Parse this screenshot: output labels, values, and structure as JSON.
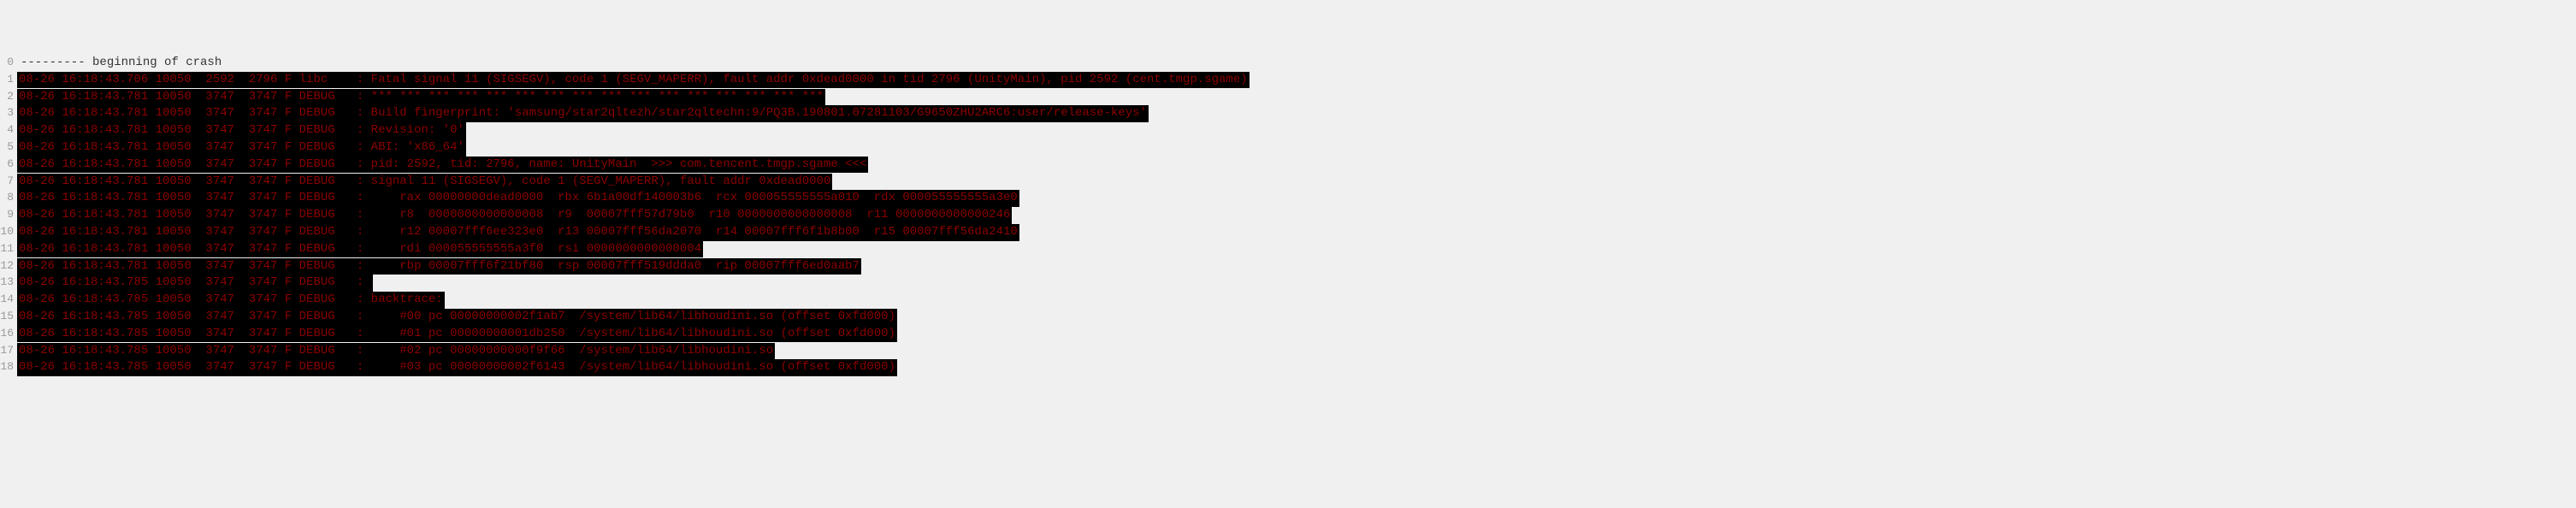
{
  "header": "--------- beginning of crash",
  "lines": [
    {
      "num": 1,
      "content": "08-26 16:18:43.706 10050  2592  2796 F libc    : Fatal signal 11 (SIGSEGV), code 1 (SEGV_MAPERR), fault addr 0xdead0000 in tid 2796 (UnityMain), pid 2592 (cent.tmgp.sgame)"
    },
    {
      "num": 2,
      "content": "08-26 16:18:43.781 10050  3747  3747 F DEBUG   : *** *** *** *** *** *** *** *** *** *** *** *** *** *** *** ***"
    },
    {
      "num": 3,
      "content": "08-26 16:18:43.781 10050  3747  3747 F DEBUG   : Build fingerprint: 'samsung/star2qltezh/star2qltechn:9/PQ3B.190801.07281103/G9650ZHU2ARC6:user/release-keys'"
    },
    {
      "num": 4,
      "content": "08-26 16:18:43.781 10050  3747  3747 F DEBUG   : Revision: '0'"
    },
    {
      "num": 5,
      "content": "08-26 16:18:43.781 10050  3747  3747 F DEBUG   : ABI: 'x86_64'"
    },
    {
      "num": 6,
      "content": "08-26 16:18:43.781 10050  3747  3747 F DEBUG   : pid: 2592, tid: 2796, name: UnityMain  >>> com.tencent.tmgp.sgame <<<"
    },
    {
      "num": 7,
      "content": "08-26 16:18:43.781 10050  3747  3747 F DEBUG   : signal 11 (SIGSEGV), code 1 (SEGV_MAPERR), fault addr 0xdead0000"
    },
    {
      "num": 8,
      "content": "08-26 16:18:43.781 10050  3747  3747 F DEBUG   :     rax 00000000dead0000  rbx 6b1a00df140003b6  rcx 000055555555a010  rdx 000055555555a3e0"
    },
    {
      "num": 9,
      "content": "08-26 16:18:43.781 10050  3747  3747 F DEBUG   :     r8  0000000000000008  r9  00007fff57d79b0  r10 0000000000000008  r11 0000000000000246"
    },
    {
      "num": 10,
      "content": "08-26 16:18:43.781 10050  3747  3747 F DEBUG   :     r12 00007fff6ee323e0  r13 00007fff56da2070  r14 00007fff6f1b8b00  r15 00007fff56da2410"
    },
    {
      "num": 11,
      "content": "08-26 16:18:43.781 10050  3747  3747 F DEBUG   :     rdi 000055555555a3f0  rsi 0000000000000004"
    },
    {
      "num": 12,
      "content": "08-26 16:18:43.781 10050  3747  3747 F DEBUG   :     rbp 00007fff6f21bf80  rsp 00007fff519ddda0  rip 00007fff6ed0aab7"
    },
    {
      "num": 13,
      "content": "08-26 16:18:43.785 10050  3747  3747 F DEBUG   : "
    },
    {
      "num": 14,
      "content": "08-26 16:18:43.785 10050  3747  3747 F DEBUG   : backtrace:"
    },
    {
      "num": 15,
      "content": "08-26 16:18:43.785 10050  3747  3747 F DEBUG   :     #00 pc 00000000002f1ab7  /system/lib64/libhoudini.so (offset 0xfd000)"
    },
    {
      "num": 16,
      "content": "08-26 16:18:43.785 10050  3747  3747 F DEBUG   :     #01 pc 00000000001db250  /system/lib64/libhoudini.so (offset 0xfd000)"
    },
    {
      "num": 17,
      "content": "08-26 16:18:43.785 10050  3747  3747 F DEBUG   :     #02 pc 00000000000f9f66  /system/lib64/libhoudini.so"
    },
    {
      "num": 18,
      "content": "08-26 16:18:43.785 10050  3747  3747 F DEBUG   :     #03 pc 00000000002f6143  /system/lib64/libhoudini.so (offset 0xfd000)"
    }
  ]
}
